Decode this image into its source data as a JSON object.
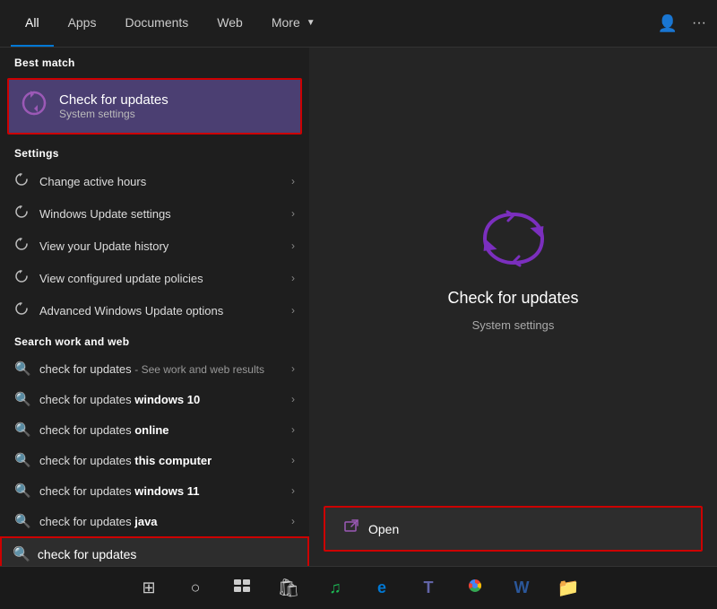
{
  "nav": {
    "tabs": [
      {
        "id": "all",
        "label": "All",
        "active": true
      },
      {
        "id": "apps",
        "label": "Apps"
      },
      {
        "id": "documents",
        "label": "Documents"
      },
      {
        "id": "web",
        "label": "Web"
      },
      {
        "id": "more",
        "label": "More"
      }
    ]
  },
  "left": {
    "best_match_label": "Best match",
    "best_match_title": "Check for updates",
    "best_match_subtitle": "System settings",
    "settings_label": "Settings",
    "settings_items": [
      {
        "id": "change-active-hours",
        "text": "Change active hours"
      },
      {
        "id": "windows-update-settings",
        "text": "Windows Update settings"
      },
      {
        "id": "view-update-history",
        "text": "View your Update history"
      },
      {
        "id": "view-configured-policies",
        "text": "View configured update policies"
      },
      {
        "id": "advanced-update-options",
        "text": "Advanced Windows Update options"
      }
    ],
    "search_web_label": "Search work and web",
    "search_web_items": [
      {
        "id": "cfu-web",
        "text": "check for updates",
        "suffix": " - See work and web results",
        "bold": false
      },
      {
        "id": "cfu-win10",
        "text": "check for updates ",
        "bold_text": "windows 10"
      },
      {
        "id": "cfu-online",
        "text": "check for updates ",
        "bold_text": "online"
      },
      {
        "id": "cfu-this-computer",
        "text": "check for updates ",
        "bold_text": "this computer"
      },
      {
        "id": "cfu-win11",
        "text": "check for updates ",
        "bold_text": "windows 11"
      },
      {
        "id": "cfu-java",
        "text": "check for updates ",
        "bold_text": "java"
      }
    ]
  },
  "right": {
    "preview_title": "Check for updates",
    "preview_subtitle": "System settings",
    "open_label": "Open"
  },
  "search_bar": {
    "value": "check for updates",
    "placeholder": "check for updates"
  },
  "taskbar": {
    "items": [
      {
        "id": "start",
        "icon": "⊞"
      },
      {
        "id": "search",
        "icon": "○"
      },
      {
        "id": "task-view",
        "icon": "⧉"
      },
      {
        "id": "store",
        "icon": "🛍"
      },
      {
        "id": "spotify",
        "icon": "♪"
      },
      {
        "id": "edge",
        "icon": "e"
      },
      {
        "id": "teams",
        "icon": "T"
      },
      {
        "id": "chrome",
        "icon": "G"
      },
      {
        "id": "word",
        "icon": "W"
      },
      {
        "id": "explorer",
        "icon": "📁"
      }
    ]
  }
}
